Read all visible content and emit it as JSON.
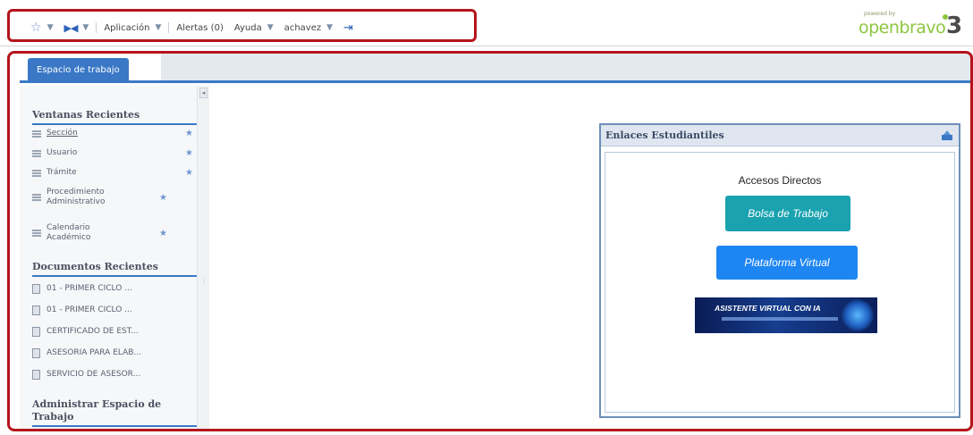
{
  "toolbar": {
    "favorites_icon": "star-icon",
    "navigation_icon": "home-icon",
    "aplicacion": "Aplicación",
    "alertas": "Alertas (0)",
    "ayuda": "Ayuda",
    "user": "achavez",
    "logout_icon": "logout-icon"
  },
  "logo": {
    "small_text": "powered by",
    "brand": "openbravo",
    "version": "3"
  },
  "tabs": [
    {
      "label": "Espacio de trabajo",
      "active": true
    }
  ],
  "sidebar": {
    "recent_windows": {
      "title": "Ventanas Recientes",
      "items": [
        {
          "label": "Sección",
          "linked": true
        },
        {
          "label": "Usuario",
          "linked": false
        },
        {
          "label": "Trámite",
          "linked": false
        },
        {
          "label": "Procedimiento Administrativo",
          "linked": false
        },
        {
          "label": "Calendario Académico",
          "linked": false
        }
      ]
    },
    "recent_documents": {
      "title": "Documentos Recientes",
      "items": [
        {
          "label": "01 - PRIMER CICLO ..."
        },
        {
          "label": "01 - PRIMER CICLO ..."
        },
        {
          "label": "CERTIFICADO DE EST..."
        },
        {
          "label": "ASESORIA PARA ELAB..."
        },
        {
          "label": "SERVICIO DE ASESOR..."
        }
      ]
    },
    "manage_workspace": {
      "title": "Administrar Espacio de Trabajo"
    }
  },
  "widget": {
    "title": "Enlaces Estudiantiles",
    "heading": "Accesos Directos",
    "btn_bolsa": "Bolsa de Trabajo",
    "btn_plataforma": "Plataforma Virtual",
    "banner_title": "ASISTENTE VIRTUAL CON IA"
  },
  "colors": {
    "accent": "#3a78c6",
    "outline": "#b5141b",
    "btn_bolsa": "#1aa2b0",
    "btn_plataforma": "#1e86f2"
  }
}
